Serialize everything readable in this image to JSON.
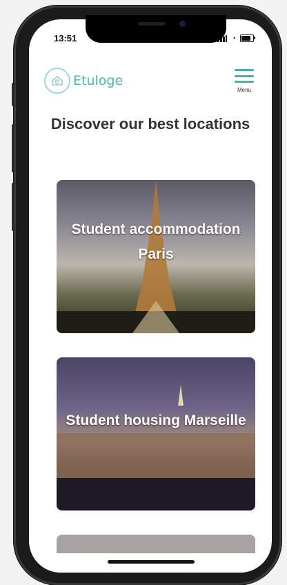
{
  "status_bar": {
    "time": "13:51"
  },
  "header": {
    "logo_text": "Etuloge",
    "menu_label": "Menu"
  },
  "page": {
    "title": "Discover our best locations"
  },
  "cards": [
    {
      "label": "Student accommodation Paris"
    },
    {
      "label": "Student housing Marseille"
    }
  ],
  "colors": {
    "accent": "#3fb3ad",
    "title": "#333333"
  },
  "icons": {
    "logo": "house-icon",
    "menu": "hamburger-icon",
    "signal": "signal-icon",
    "wifi": "wifi-icon",
    "battery": "battery-icon"
  }
}
